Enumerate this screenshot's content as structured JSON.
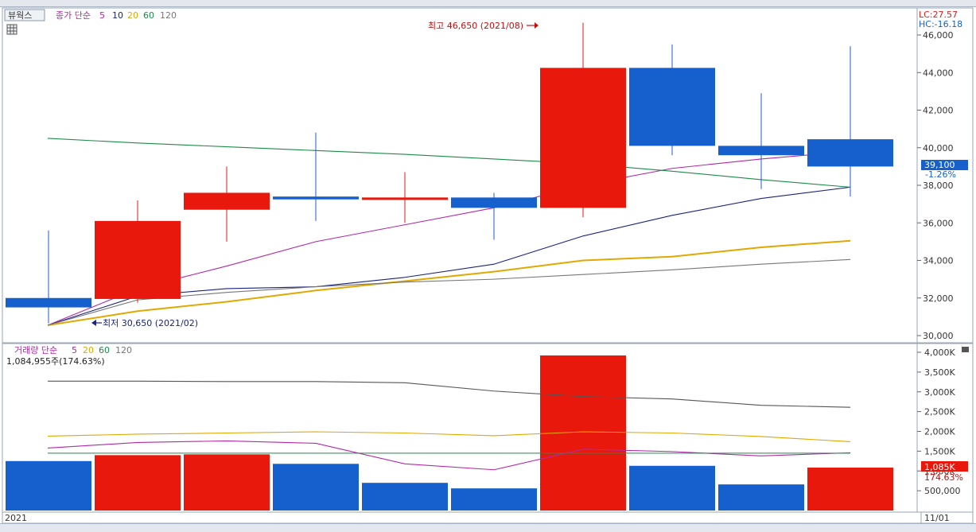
{
  "toolbar": {
    "view_button": "뷰웍스",
    "grid_icon": "grid-icon"
  },
  "price_panel": {
    "legend": {
      "label": "종가 단순",
      "periods": [
        {
          "label": "5",
          "color": "#b02aa8"
        },
        {
          "label": "10",
          "color": "#1a237e"
        },
        {
          "label": "20",
          "color": "#e0a800"
        },
        {
          "label": "60",
          "color": "#1e8a4a"
        },
        {
          "label": "120",
          "color": "#777777"
        }
      ]
    },
    "lc_label": "LC:27.57",
    "hc_label": "HC:-16.18",
    "high_marker": "최고 46,650 (2021/08)",
    "low_marker": "최저 30,650 (2021/02)",
    "current_price": "39,100",
    "current_change": "-1.26%"
  },
  "volume_panel": {
    "legend": {
      "label": "거래량 단순",
      "periods": [
        {
          "label": "5",
          "color": "#b02aa8"
        },
        {
          "label": "20",
          "color": "#e0a800"
        },
        {
          "label": "60",
          "color": "#1e8a4a"
        },
        {
          "label": "120",
          "color": "#777777"
        }
      ]
    },
    "info": "1,084,955주(174.63%)",
    "current_volume": "1,085K",
    "current_ratio": "174.63%"
  },
  "x_axis": {
    "start_label": "2021",
    "end_label": "11/01"
  },
  "colors": {
    "up": "#e8190c",
    "down": "#1560cc"
  },
  "chart_data": [
    {
      "type": "candlestick",
      "ylim": [
        30000,
        46000
      ],
      "y_ticks": [
        "30,000",
        "32,000",
        "34,000",
        "36,000",
        "38,000",
        "40,000",
        "42,000",
        "44,000",
        "46,000"
      ],
      "candles": [
        {
          "open": 32000,
          "high": 35600,
          "low": 30650,
          "close": 31500,
          "dir": "down"
        },
        {
          "open": 31950,
          "high": 37200,
          "low": 31750,
          "close": 36100,
          "dir": "up"
        },
        {
          "open": 36700,
          "high": 39000,
          "low": 35000,
          "close": 37600,
          "dir": "up"
        },
        {
          "open": 37400,
          "high": 40800,
          "low": 36100,
          "close": 37250,
          "dir": "down"
        },
        {
          "open": 37250,
          "high": 38700,
          "low": 36000,
          "close": 37350,
          "dir": "up"
        },
        {
          "open": 37350,
          "high": 37600,
          "low": 35100,
          "close": 36800,
          "dir": "down"
        },
        {
          "open": 36800,
          "high": 46650,
          "low": 36300,
          "close": 44250,
          "dir": "up"
        },
        {
          "open": 44250,
          "high": 45500,
          "low": 39600,
          "close": 40100,
          "dir": "down"
        },
        {
          "open": 40100,
          "high": 42900,
          "low": 37800,
          "close": 39600,
          "dir": "down"
        },
        {
          "open": 40450,
          "high": 45400,
          "low": 37400,
          "close": 39000,
          "dir": "down"
        }
      ],
      "ma_series": [
        {
          "name": "5",
          "color": "#b02aa8",
          "values": [
            30550,
            32500,
            33700,
            35000,
            35900,
            36800,
            38000,
            38900,
            39400,
            39800
          ]
        },
        {
          "name": "10",
          "color": "#1a237e",
          "values": [
            30550,
            32100,
            32500,
            32600,
            33100,
            33800,
            35300,
            36400,
            37300,
            37900
          ]
        },
        {
          "name": "20",
          "color": "#e0a800",
          "values": [
            30550,
            31300,
            31800,
            32400,
            32900,
            33400,
            34000,
            34200,
            34700,
            35050
          ]
        },
        {
          "name": "60",
          "color": "#1e8a4a",
          "values": [
            40500,
            40250,
            40050,
            39850,
            39650,
            39400,
            39150,
            38750,
            38300,
            37900
          ]
        },
        {
          "name": "120",
          "color": "#777777",
          "values": [
            30550,
            31900,
            32300,
            32600,
            32850,
            33000,
            33250,
            33500,
            33800,
            34050
          ]
        }
      ]
    },
    {
      "type": "bar",
      "ylim": [
        0,
        4000000
      ],
      "y_ticks": [
        "500,000",
        "1,000K",
        "1,500K",
        "2,000K",
        "2,500K",
        "3,000K",
        "3,500K",
        "4,000K"
      ],
      "values": [
        1250000,
        1400000,
        1420000,
        1180000,
        700000,
        560000,
        3920000,
        1130000,
        660000,
        1085000
      ],
      "dir": [
        "down",
        "up",
        "up",
        "down",
        "down",
        "down",
        "up",
        "down",
        "down",
        "up"
      ],
      "ma_series": [
        {
          "name": "5",
          "color": "#b02aa8",
          "values": [
            1580000,
            1720000,
            1760000,
            1700000,
            1180000,
            1030000,
            1550000,
            1490000,
            1380000,
            1460000
          ]
        },
        {
          "name": "20",
          "color": "#e0a800",
          "values": [
            1880000,
            1930000,
            1960000,
            1990000,
            1960000,
            1890000,
            1990000,
            1960000,
            1870000,
            1740000
          ]
        },
        {
          "name": "60",
          "color": "#1e8a4a",
          "values": [
            1450000,
            1450000,
            1450000,
            1450000,
            1450000,
            1450000,
            1450000,
            1450000,
            1450000,
            1450000
          ]
        },
        {
          "name": "120",
          "color": "#555555",
          "values": [
            3270000,
            3270000,
            3260000,
            3260000,
            3230000,
            3020000,
            2880000,
            2820000,
            2660000,
            2610000
          ]
        }
      ]
    }
  ]
}
